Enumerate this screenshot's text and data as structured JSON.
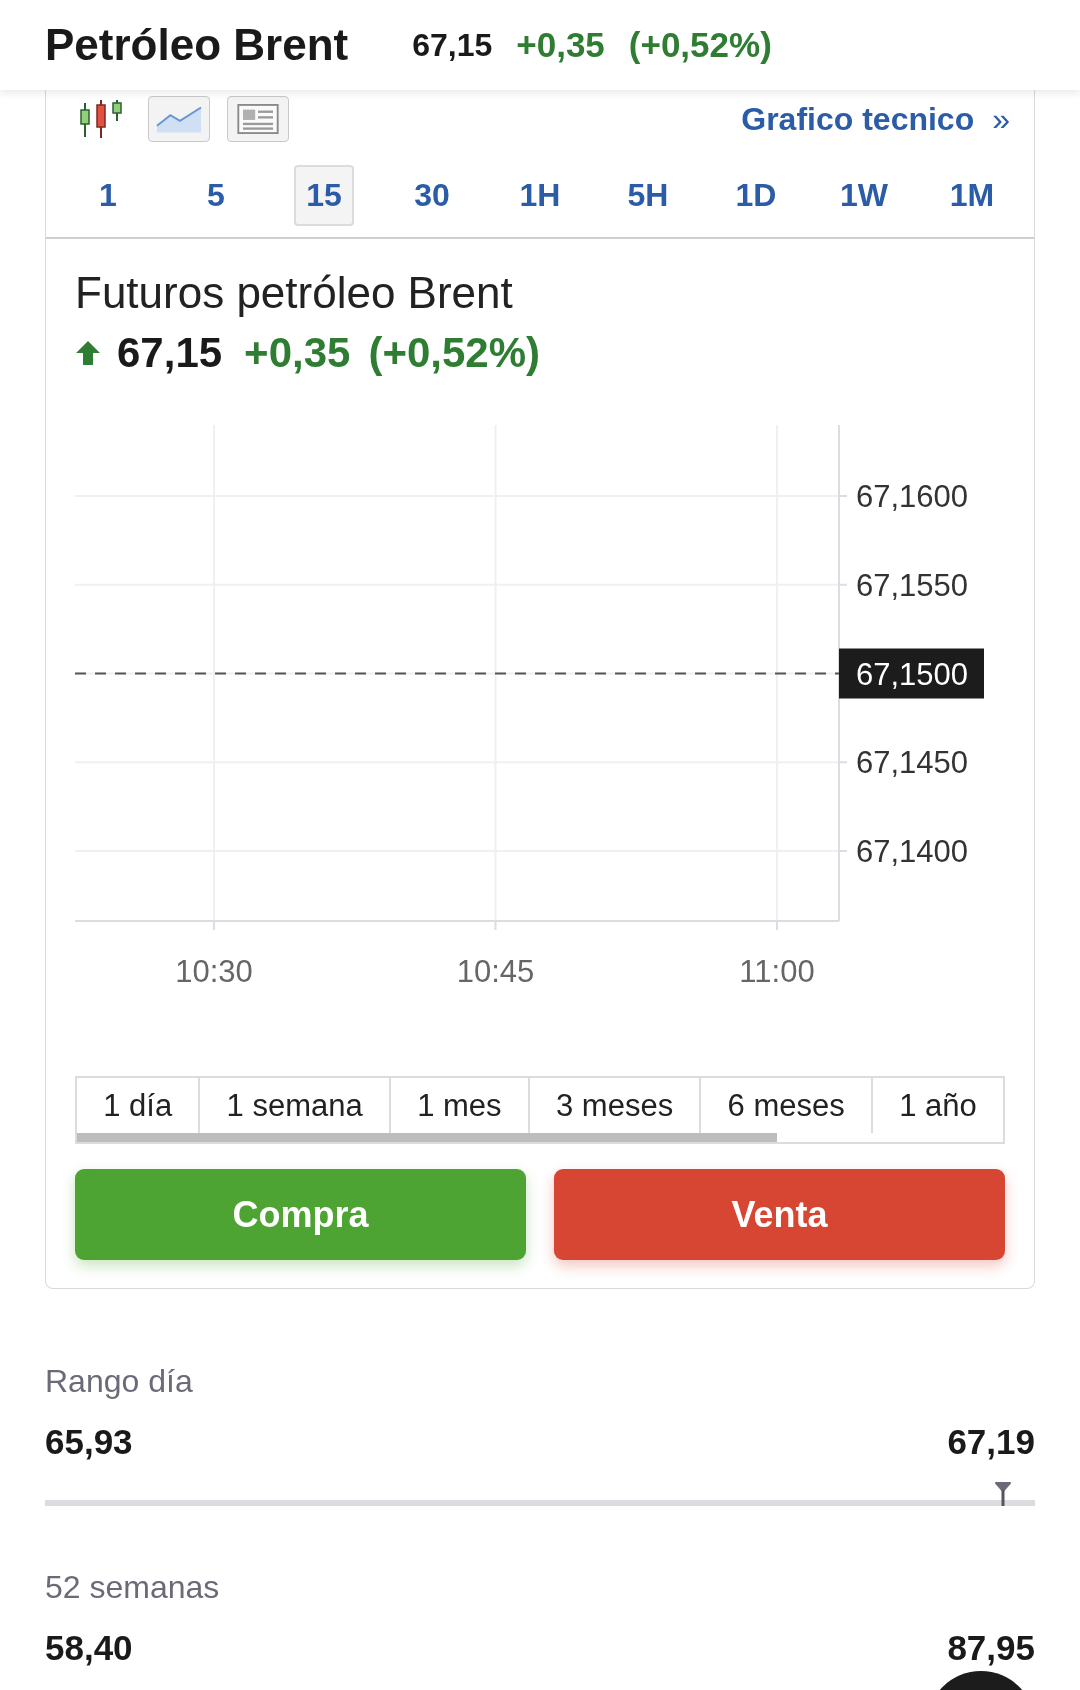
{
  "header": {
    "title": "Petróleo Brent",
    "price": "67,15",
    "change": "+0,35",
    "change_pct": "(+0,52%)"
  },
  "chart_toolbar": {
    "link": "Grafico tecnico",
    "link_arrow": "»"
  },
  "interval_tabs": [
    {
      "label": "1",
      "selected": false
    },
    {
      "label": "5",
      "selected": false
    },
    {
      "label": "15",
      "selected": true
    },
    {
      "label": "30",
      "selected": false
    },
    {
      "label": "1H",
      "selected": false
    },
    {
      "label": "5H",
      "selected": false
    },
    {
      "label": "1D",
      "selected": false
    },
    {
      "label": "1W",
      "selected": false
    },
    {
      "label": "1M",
      "selected": false
    }
  ],
  "quote": {
    "title": "Futuros petróleo Brent",
    "price": "67,15",
    "change": "+0,35",
    "change_pct": "(+0,52%)"
  },
  "chart": {
    "y_labels": [
      {
        "label": "67,1600",
        "kind": "tick"
      },
      {
        "label": "67,1550",
        "kind": "tick"
      },
      {
        "label": "67,1500",
        "kind": "price"
      },
      {
        "label": "67,1450",
        "kind": "tick"
      },
      {
        "label": "67,1400",
        "kind": "tick"
      }
    ],
    "x_labels": [
      "10:30",
      "10:45",
      "11:00"
    ]
  },
  "range_tabs": [
    {
      "label": "1 día",
      "selected": false
    },
    {
      "label": "1 semana",
      "selected": false
    },
    {
      "label": "1 mes",
      "selected": false
    },
    {
      "label": "3 meses",
      "selected": false
    },
    {
      "label": "6 meses",
      "selected": false
    },
    {
      "label": "1 año",
      "selected": false
    }
  ],
  "trade_buttons": [
    {
      "label": "Compra",
      "kind": "buy"
    },
    {
      "label": "Venta",
      "kind": "sell"
    }
  ],
  "stats": [
    {
      "label": "Rango día",
      "low": "65,93",
      "high": "67,19",
      "level": 0.968
    },
    {
      "label": "52 semanas",
      "low": "58,40",
      "high": "87,95"
    }
  ]
}
